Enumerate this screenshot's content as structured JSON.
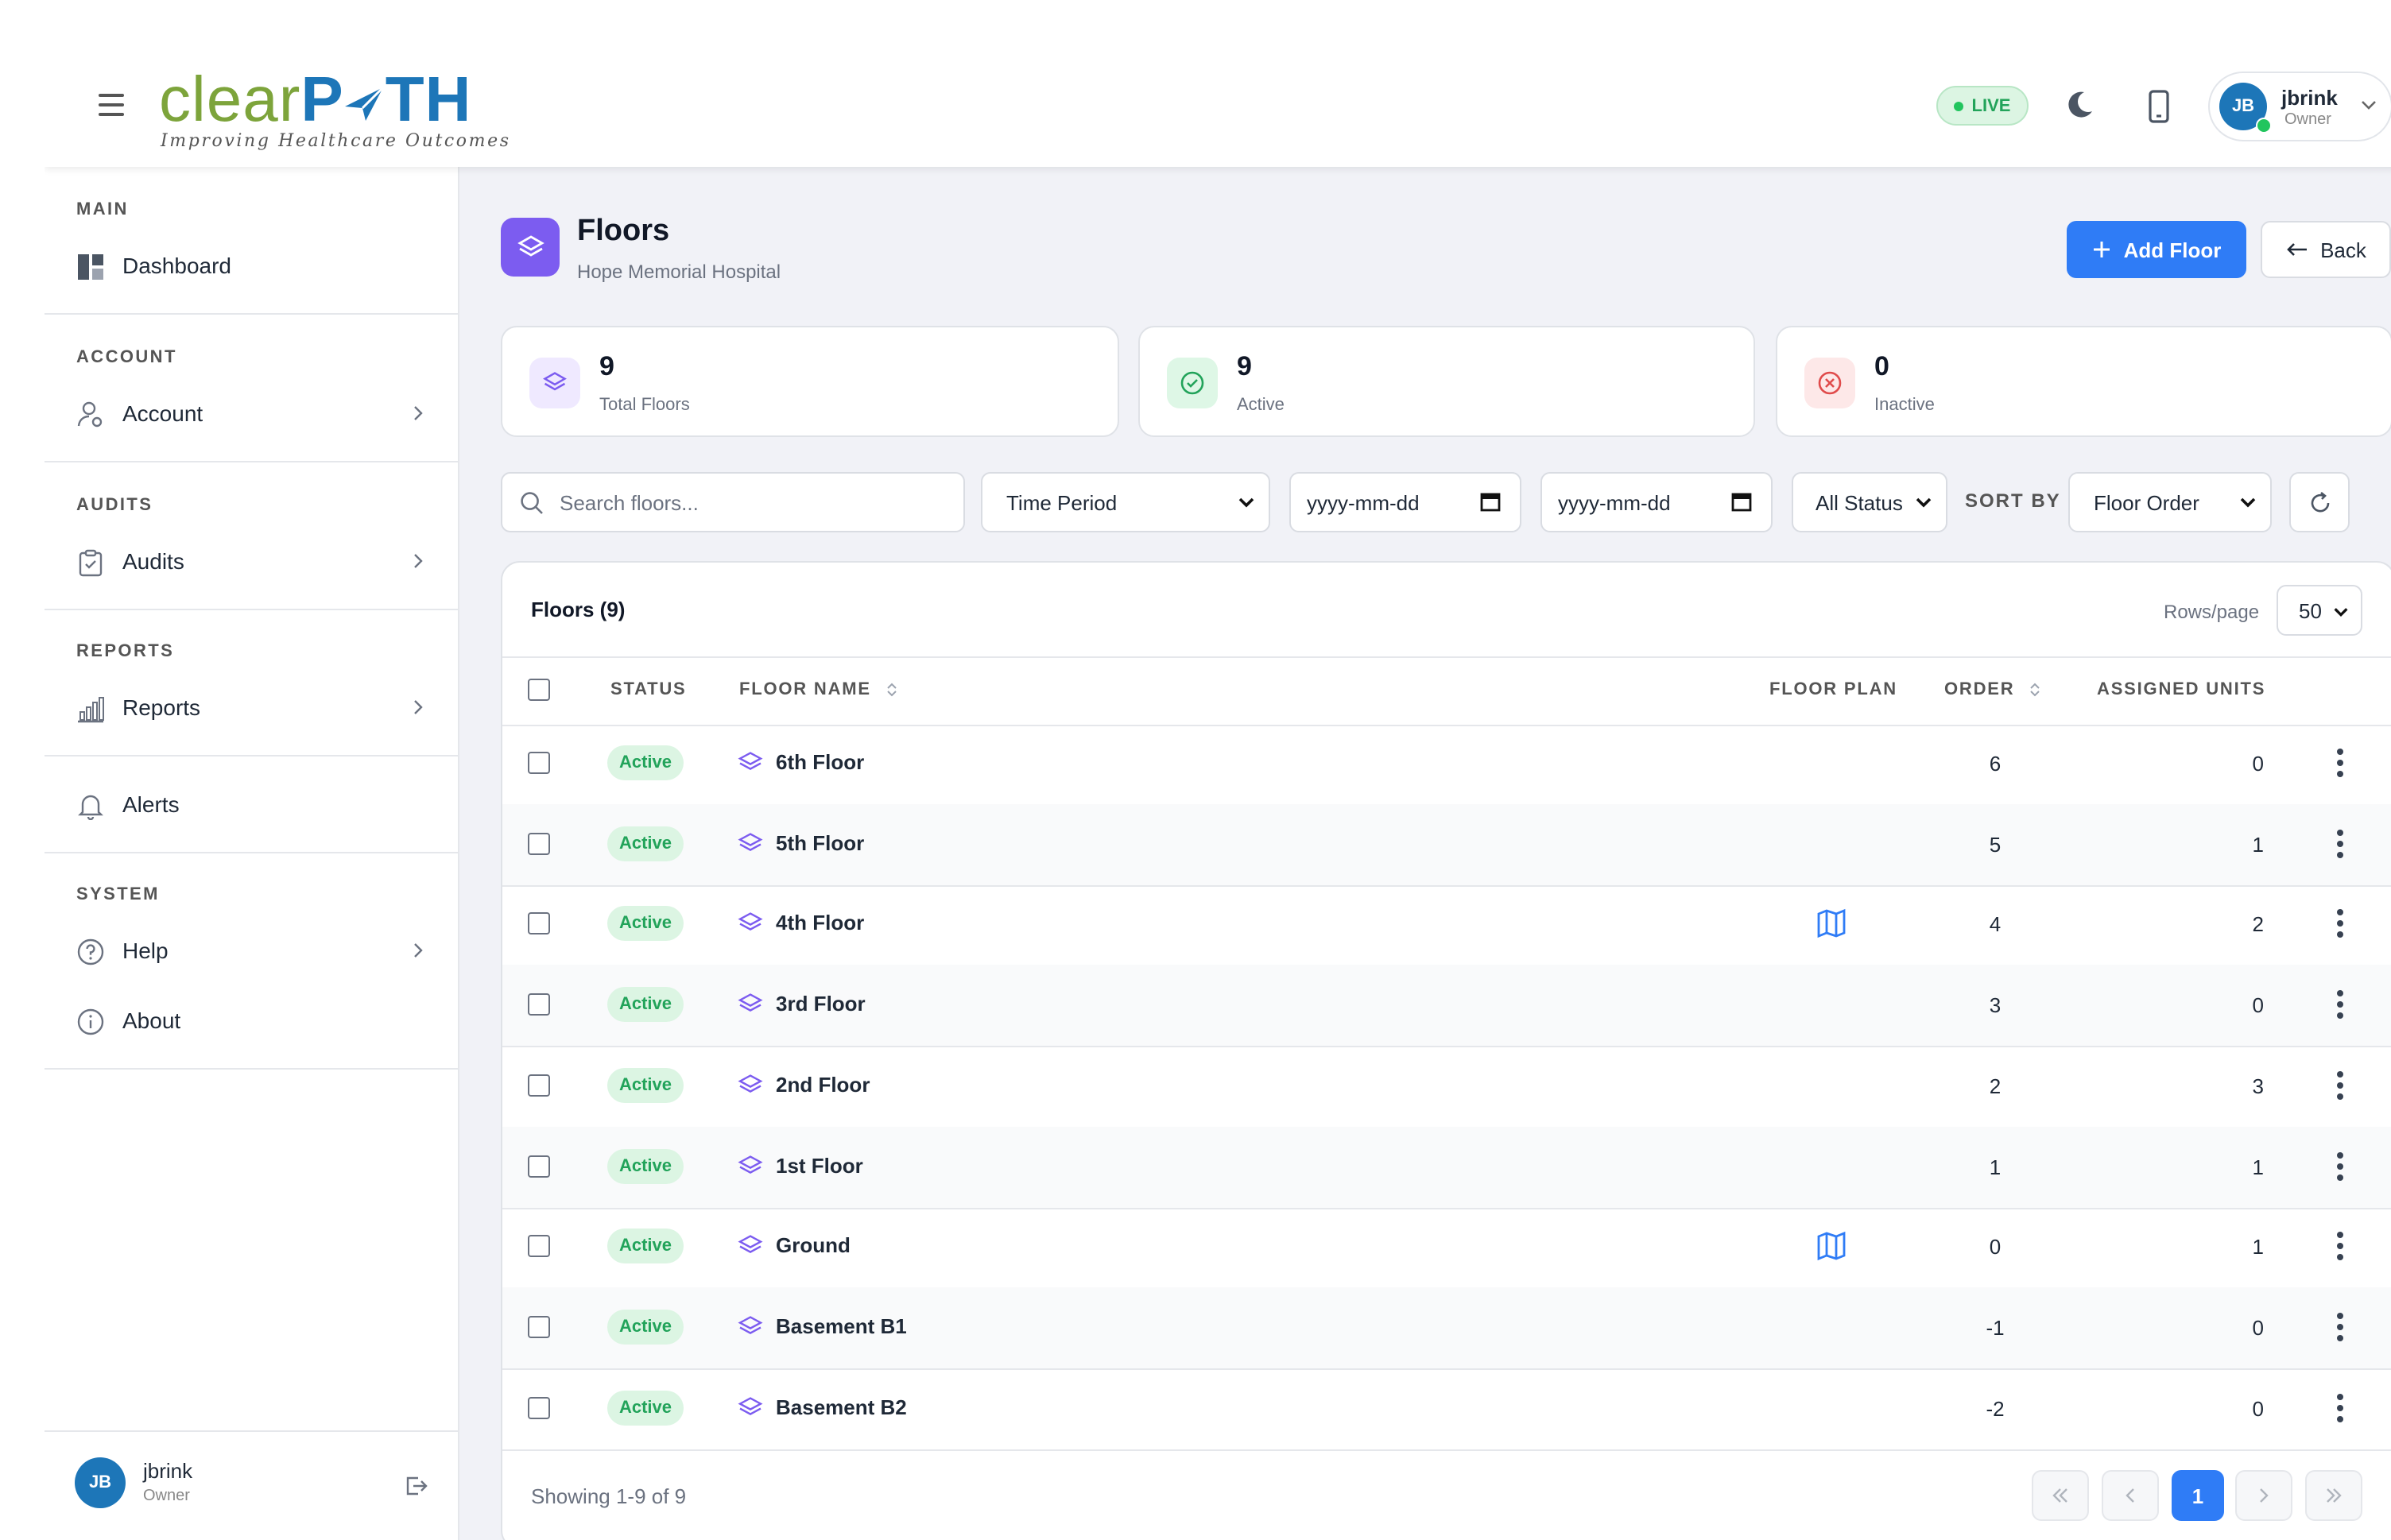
{
  "header": {
    "logo": {
      "part1": "clear",
      "part2": "P",
      "part3": "TH",
      "tagline": "Improving Healthcare Outcomes"
    },
    "live_label": "LIVE",
    "user": {
      "initials": "JB",
      "name": "jbrink",
      "role": "Owner"
    },
    "icons": {
      "menu": "hamburger-icon",
      "theme": "moon-icon",
      "device": "mobile-icon",
      "dropdown": "chevron-down-icon"
    }
  },
  "sidebar": {
    "sections": {
      "main": "MAIN",
      "account": "ACCOUNT",
      "audits": "AUDITS",
      "reports": "REPORTS",
      "system": "SYSTEM"
    },
    "items": {
      "dashboard": "Dashboard",
      "account": "Account",
      "audits": "Audits",
      "reports": "Reports",
      "alerts": "Alerts",
      "help": "Help",
      "about": "About"
    },
    "user": {
      "initials": "JB",
      "name": "jbrink",
      "role": "Owner"
    }
  },
  "page": {
    "title": "Floors",
    "subtitle": "Hope Memorial Hospital",
    "add_button": "Add Floor",
    "back_button": "Back"
  },
  "stats": {
    "total": {
      "value": "9",
      "label": "Total Floors"
    },
    "active": {
      "value": "9",
      "label": "Active"
    },
    "inactive": {
      "value": "0",
      "label": "Inactive"
    }
  },
  "filters": {
    "search_placeholder": "Search floors...",
    "time_period": "Time Period",
    "date_from": "yyyy-mm-dd",
    "date_to": "yyyy-mm-dd",
    "status": "All Status",
    "sort_by_label": "SORT BY",
    "sort_by": "Floor Order"
  },
  "table": {
    "title": "Floors (9)",
    "rows_per_page_label": "Rows/page",
    "rows_per_page": "50",
    "columns": {
      "status": "STATUS",
      "floor_name": "FLOOR NAME",
      "floor_plan": "FLOOR PLAN",
      "order": "ORDER",
      "assigned_units": "ASSIGNED UNITS"
    },
    "rows": [
      {
        "status": "Active",
        "name": "6th Floor",
        "has_plan": false,
        "order": "6",
        "units": "0"
      },
      {
        "status": "Active",
        "name": "5th Floor",
        "has_plan": false,
        "order": "5",
        "units": "1"
      },
      {
        "status": "Active",
        "name": "4th Floor",
        "has_plan": true,
        "order": "4",
        "units": "2"
      },
      {
        "status": "Active",
        "name": "3rd Floor",
        "has_plan": false,
        "order": "3",
        "units": "0"
      },
      {
        "status": "Active",
        "name": "2nd Floor",
        "has_plan": false,
        "order": "2",
        "units": "3"
      },
      {
        "status": "Active",
        "name": "1st Floor",
        "has_plan": false,
        "order": "1",
        "units": "1"
      },
      {
        "status": "Active",
        "name": "Ground",
        "has_plan": true,
        "order": "0",
        "units": "1"
      },
      {
        "status": "Active",
        "name": "Basement B1",
        "has_plan": false,
        "order": "-1",
        "units": "0"
      },
      {
        "status": "Active",
        "name": "Basement B2",
        "has_plan": false,
        "order": "-2",
        "units": "0"
      }
    ],
    "showing": "Showing 1-9 of 9",
    "current_page": "1"
  },
  "colors": {
    "primary": "#2f7cf6",
    "accent_purple": "#7c5cf0",
    "active_green": "#22a35a",
    "logo_green": "#7da43b",
    "logo_blue": "#1d76b8"
  }
}
